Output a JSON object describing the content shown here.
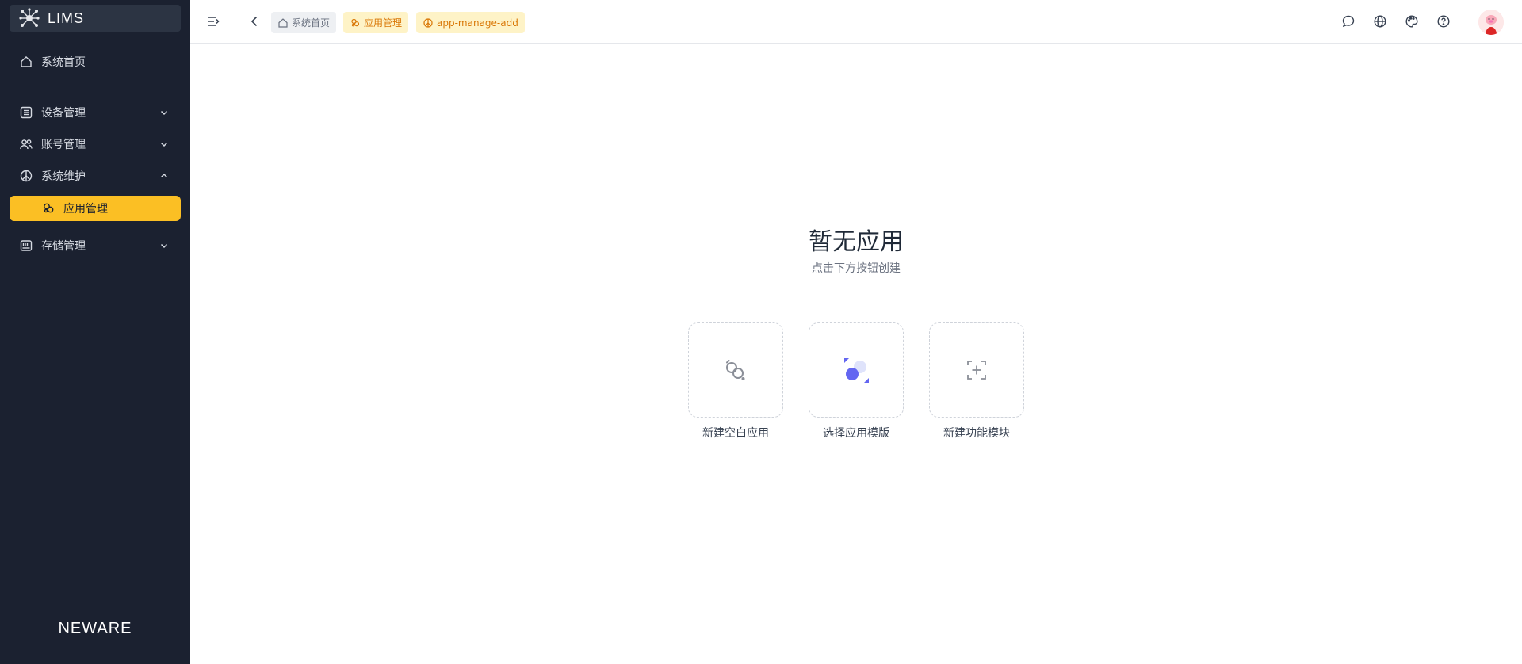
{
  "app": {
    "brand": "LIMS",
    "footer": "NEWARE"
  },
  "sidebar": {
    "items": [
      {
        "label": "系统首页",
        "icon": "home-icon"
      },
      {
        "label": "设备管理",
        "icon": "device-list-icon",
        "expanded": false
      },
      {
        "label": "账号管理",
        "icon": "users-icon",
        "expanded": false
      },
      {
        "label": "系统维护",
        "icon": "peace-icon",
        "expanded": true
      },
      {
        "label": "应用管理",
        "icon": "app-icon",
        "active": true,
        "child": true
      },
      {
        "label": "存储管理",
        "icon": "storage-icon",
        "expanded": false
      }
    ]
  },
  "header": {
    "breadcrumbs": [
      {
        "label": "系统首页",
        "icon": "home-icon"
      },
      {
        "label": "应用管理",
        "icon": "app-icon"
      },
      {
        "label": "app-manage-add",
        "icon": "peace-icon"
      }
    ],
    "actions": [
      "message-icon",
      "globe-icon",
      "palette-icon",
      "help-icon",
      "avatar"
    ]
  },
  "main": {
    "empty_title": "暂无应用",
    "empty_subtitle": "点击下方按钮创建",
    "options": [
      {
        "label": "新建空白应用",
        "icon": "blank-app-icon"
      },
      {
        "label": "选择应用模版",
        "icon": "template-icon"
      },
      {
        "label": "新建功能模块",
        "icon": "add-module-icon"
      }
    ]
  },
  "colors": {
    "sidebar_bg": "#1b2130",
    "accent": "#fbbf24",
    "template_purple": "#6366f1"
  }
}
